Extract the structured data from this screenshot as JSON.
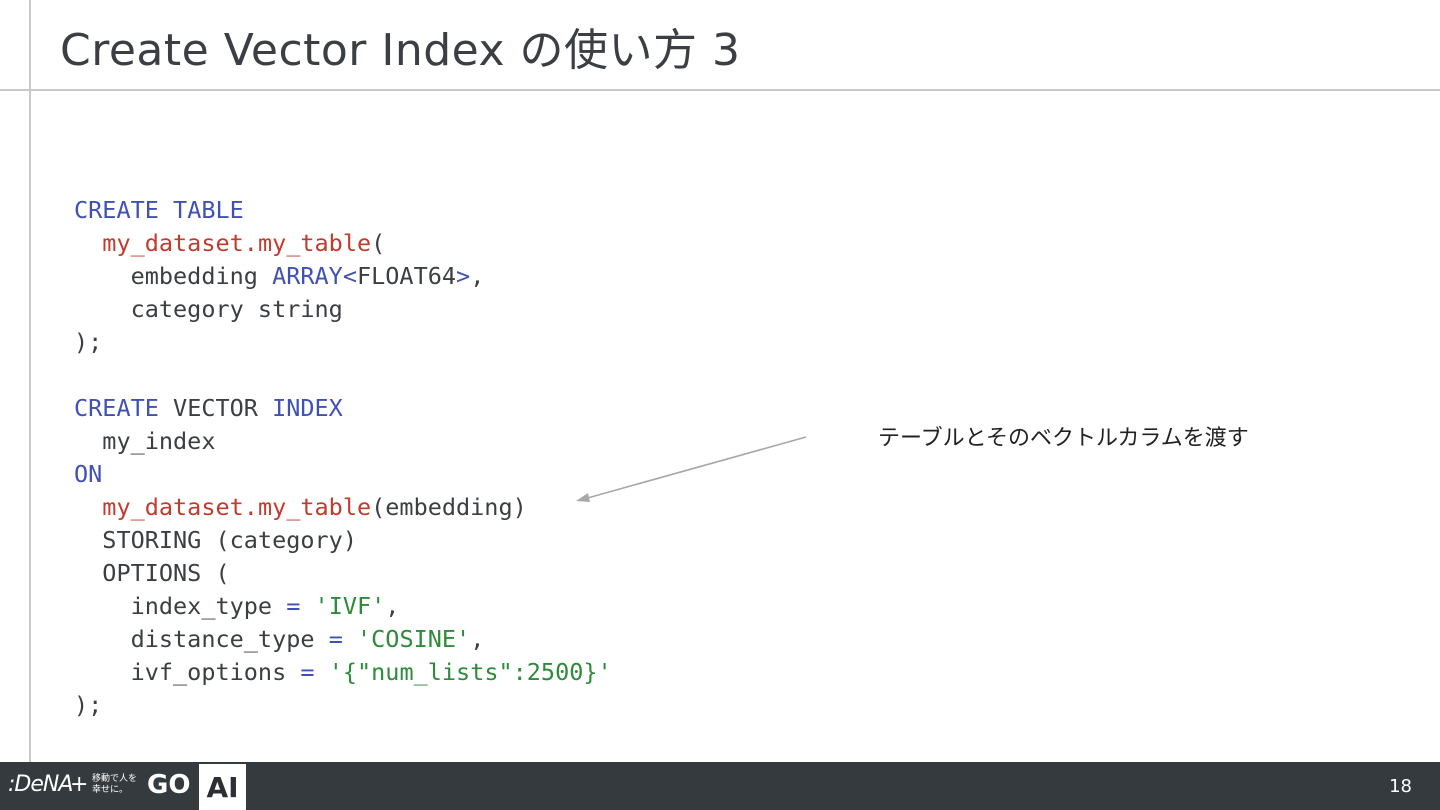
{
  "slide": {
    "title": "Create Vector Index の使い方 3",
    "annotation": "テーブルとそのベクトルカラムを渡す",
    "page_number": "18"
  },
  "code": {
    "l1_kw1": "CREATE",
    "l1_kw2": "TABLE",
    "l2_id1": "my_dataset",
    "l2_dot": ".",
    "l2_id2": "my_table",
    "l2_paren": "(",
    "l3_name": "embedding",
    "l3_type": "ARRAY<",
    "l3_inner": "FLOAT64",
    "l3_close": ">",
    "l3_comma": ",",
    "l4": "category string",
    "l5": ");",
    "l7_kw1": "CREATE",
    "l7_mid": "VECTOR",
    "l7_kw2": "INDEX",
    "l8": "my_index",
    "l9_kw": "ON",
    "l10_id1": "my_dataset",
    "l10_dot": ".",
    "l10_id2": "my_table",
    "l10_rest": "(embedding)",
    "l11": "STORING (category)",
    "l12": "OPTIONS (",
    "l13_key": "index_type",
    "l13_eq": "=",
    "l13_val": "'IVF'",
    "l13_comma": ",",
    "l14_key": "distance_type",
    "l14_eq": "=",
    "l14_val": "'COSINE'",
    "l14_comma": ",",
    "l15_key": "ivf_options",
    "l15_eq": "=",
    "l15_q1": "'",
    "l15_val": "{\"num_lists\":2500}",
    "l15_q2": "'",
    "l16": ");"
  },
  "footer": {
    "logo_dena": ":DeNA",
    "logo_plus": "+",
    "logo_jp": "移動で人を幸せに。",
    "logo_go": "GO",
    "logo_ai": "AI"
  },
  "colors": {
    "keyword": "#3f51b5",
    "identifier": "#c23b2e",
    "string": "#2e8b3a",
    "text": "#3b3f43",
    "footer_bg": "#353a3e"
  }
}
